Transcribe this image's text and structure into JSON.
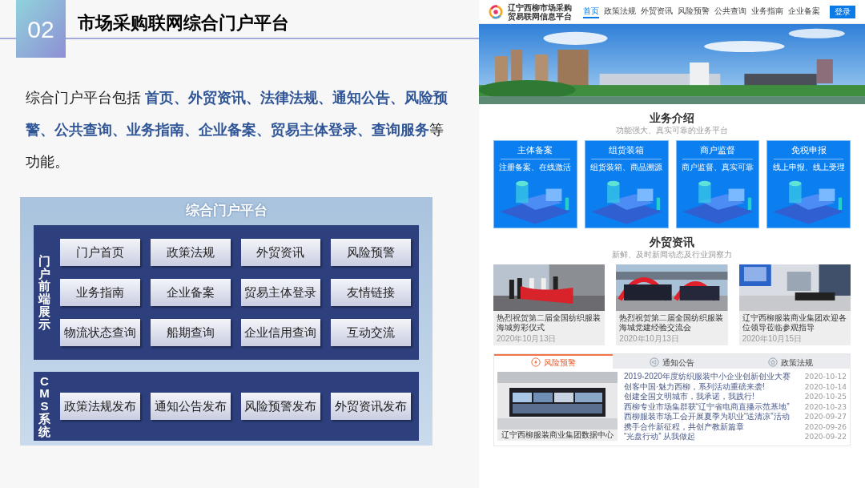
{
  "slide": {
    "number": "02",
    "title": "市场采购联网综合门户平台",
    "paragraph": "综合门户平台包括 **首页、外贸资讯、法律法规、通知公告、风险预警、公共查询、业务指南、企业备案、贸易主体登录、查询服务**等功能。"
  },
  "diagram": {
    "title": "综合门户平台",
    "groups": [
      {
        "label": "门户前端展示",
        "items": [
          "门户首页",
          "政策法规",
          "外贸资讯",
          "风险预警",
          "业务指南",
          "企业备案",
          "贸易主体登录",
          "友情链接",
          "物流状态查询",
          "船期查询",
          "企业信用查询",
          "互动交流"
        ]
      },
      {
        "label": "CMS系统",
        "items": [
          "政策法规发布",
          "通知公告发布",
          "风险预警发布",
          "外贸资讯发布"
        ]
      }
    ]
  },
  "website": {
    "logo_line_1": "辽宁西柳市场采购",
    "logo_line_2": "贸易联网信息平台",
    "nav": [
      {
        "label": "首页",
        "selected": true
      },
      {
        "label": "政策法规",
        "selected": false
      },
      {
        "label": "外贸资讯",
        "selected": false
      },
      {
        "label": "风险预警",
        "selected": false
      },
      {
        "label": "公共查询",
        "selected": false
      },
      {
        "label": "业务指南",
        "selected": false
      },
      {
        "label": "企业备案",
        "selected": false
      }
    ],
    "login_button": "登录",
    "business": {
      "title": "业务介绍",
      "subtitle": "功能强大、真实可靠的业务平台",
      "cards": [
        {
          "title": "主体备案",
          "subtitle": "注册备案、在线激活"
        },
        {
          "title": "组货装箱",
          "subtitle": "组货装箱、商品溯源"
        },
        {
          "title": "商户监督",
          "subtitle": "商户监督、真实可靠"
        },
        {
          "title": "免税申报",
          "subtitle": "线上申报、线上受理"
        }
      ]
    },
    "news": {
      "title": "外贸资讯",
      "subtitle": "新鲜、及时新闻动态及行业洞察力",
      "items": [
        {
          "title": "热烈祝贺第二届全国纺织服装海城剪彩仪式",
          "date": "2020年10月13日"
        },
        {
          "title": "热烈祝贺第二届全国纺织服装海城党建经验交流会",
          "date": "2020年10月13日"
        },
        {
          "title": "辽宁西柳服装商业集团欢迎各位领导莅临参观指导",
          "date": "2020年10月15日"
        }
      ]
    },
    "tabs": [
      {
        "label": "风险预警",
        "selected": true
      },
      {
        "label": "通知公告",
        "selected": false
      },
      {
        "label": "政策法规",
        "selected": false
      }
    ],
    "feature_caption": "辽宁西柳服装商业集团数据中心",
    "list": [
      {
        "title": "2019-2020年度纺织服装中小企业创新创业大赛",
        "date": "2020-10-12"
      },
      {
        "title": "创客中国·魅力西柳，系列活动重磅来袭!",
        "date": "2020-10-14"
      },
      {
        "title": "创建全国文明城市，我承诺，我践行!",
        "date": "2020-10-25"
      },
      {
        "title": "西柳专业市场集群获“辽宁省电商直播示范基地”",
        "date": "2020-10-23"
      },
      {
        "title": "西柳服装市场工会开展夏季为职业“送清凉”活动",
        "date": "2020-09-27"
      },
      {
        "title": "携手合作新征程，共创产教新篇章",
        "date": "2020-09-26"
      },
      {
        "title": "“光盘行动” 从我做起",
        "date": "2020-09-22"
      }
    ]
  }
}
